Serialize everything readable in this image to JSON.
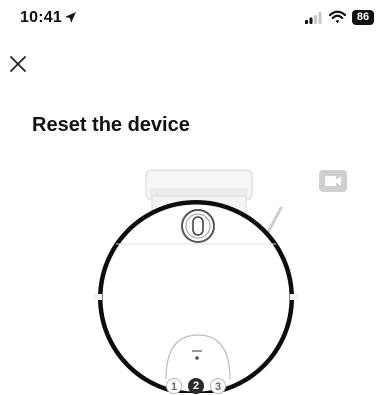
{
  "status_bar": {
    "time": "10:41",
    "battery": "86"
  },
  "header": {
    "title": "Reset the device"
  },
  "steps": [
    "1",
    "2",
    "3"
  ],
  "icons": {
    "close": "close-icon",
    "video": "video-camera-icon",
    "location": "location-arrow-icon",
    "signal": "cellular-signal-icon",
    "wifi": "wifi-icon"
  },
  "colors": {
    "text": "#111111",
    "video_icon": "#cfcfcf",
    "active_step": "#2a2a2a"
  }
}
